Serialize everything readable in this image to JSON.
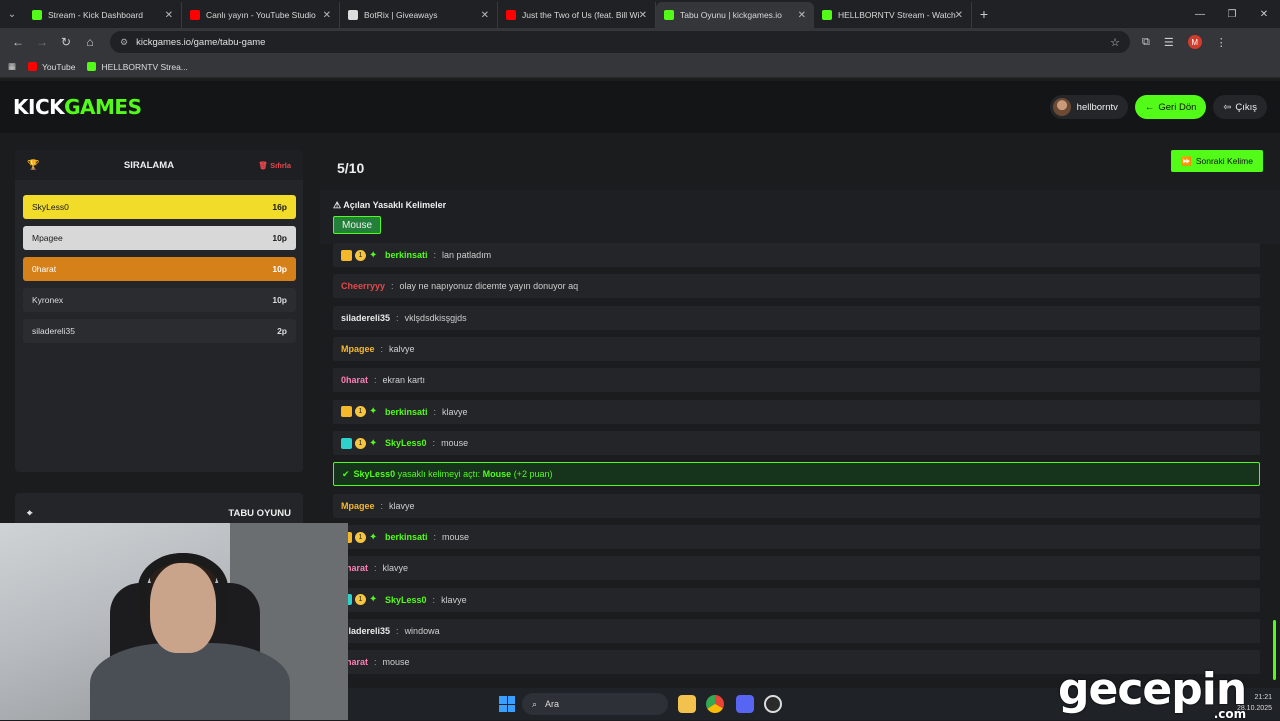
{
  "browser": {
    "tabs": [
      {
        "title": "Stream - Kick Dashboard",
        "icon": "kick-icon",
        "color": "#53fc18"
      },
      {
        "title": "Canlı yayın - YouTube Studio",
        "icon": "youtube-icon",
        "color": "#ff0000"
      },
      {
        "title": "BotRix | Giveaways",
        "icon": "botrix-icon",
        "color": "#dddddd"
      },
      {
        "title": "Just the Two of Us (feat. Bill Wi",
        "icon": "youtube-icon",
        "color": "#ff0000"
      },
      {
        "title": "Tabu Oyunu | kickgames.io",
        "icon": "kickgames-icon",
        "color": "#53fc18"
      },
      {
        "title": "HELLBORNTV Stream - Watch L",
        "icon": "kick-icon",
        "color": "#53fc18"
      }
    ],
    "url": "kickgames.io/game/tabu-game",
    "profile_initial": "M",
    "bookmarks": [
      {
        "label": "YouTube",
        "color": "#ff0000"
      },
      {
        "label": "HELLBORNTV Strea...",
        "color": "#53fc18"
      }
    ]
  },
  "header": {
    "logo_part1": "KICK",
    "logo_part2": "GAMES",
    "username": "hellborntv",
    "back_label": "Geri Dön",
    "logout_label": "Çıkış"
  },
  "ranking": {
    "title": "SIRALAMA",
    "reset_label": "Sıfırla",
    "rows": [
      {
        "name": "SkyLess0",
        "points": "16p"
      },
      {
        "name": "Mpagee",
        "points": "10p"
      },
      {
        "name": "0harat",
        "points": "10p"
      },
      {
        "name": "Kyronex",
        "points": "10p"
      },
      {
        "name": "siladereli35",
        "points": "2p"
      }
    ]
  },
  "tabu_panel": {
    "title": "TABU OYUNU"
  },
  "game": {
    "round": "5/10",
    "next_word_label": "Sonraki Kelime",
    "banned_title": "Açılan Yasaklı Kelimeler",
    "banned_words": [
      "Mouse"
    ]
  },
  "chat": [
    {
      "user": "berkinsati",
      "text": "lan patladım",
      "color": "#53fc18",
      "badges": [
        "crown",
        "sub",
        "star"
      ]
    },
    {
      "user": "Cheerryyy",
      "text": "olay ne napıyonuz dicemte yayın donuyor aq",
      "color": "#e5484d",
      "badges": []
    },
    {
      "user": "siladereli35",
      "text": "vklşdsdkisşgjds",
      "color": "#eaeaea",
      "badges": []
    },
    {
      "user": "Mpagee",
      "text": "kalvye",
      "color": "#f5b82b",
      "badges": []
    },
    {
      "user": "0harat",
      "text": "ekran kartı",
      "color": "#ff7eb6",
      "badges": []
    },
    {
      "user": "berkinsati",
      "text": "klavye",
      "color": "#53fc18",
      "badges": [
        "crown",
        "sub",
        "star"
      ]
    },
    {
      "user": "SkyLess0",
      "text": "mouse",
      "color": "#53fc18",
      "badges": [
        "og",
        "sub",
        "star"
      ]
    },
    {
      "system": true,
      "user": "SkyLess0",
      "middle": "yasaklı kelimeyi açtı:",
      "word": "Mouse",
      "bonus": "(+2 puan)"
    },
    {
      "user": "Mpagee",
      "text": "klavye",
      "color": "#f5b82b",
      "badges": []
    },
    {
      "user": "berkinsati",
      "text": "mouse",
      "color": "#53fc18",
      "badges": [
        "crown",
        "sub",
        "star"
      ]
    },
    {
      "user": "0harat",
      "text": "klavye",
      "color": "#ff7eb6",
      "badges": []
    },
    {
      "user": "SkyLess0",
      "text": "klavye",
      "color": "#53fc18",
      "badges": [
        "og",
        "sub",
        "star"
      ]
    },
    {
      "user": "siladereli35",
      "text": "windowa",
      "color": "#eaeaea",
      "badges": []
    },
    {
      "user": "0harat",
      "text": "mouse",
      "color": "#ff7eb6",
      "badges": []
    }
  ],
  "taskbar": {
    "search_label": "Ara",
    "time": "21:21",
    "date": "28.10.2025"
  },
  "watermark": {
    "text": "gecepin",
    "suffix": ".com"
  }
}
